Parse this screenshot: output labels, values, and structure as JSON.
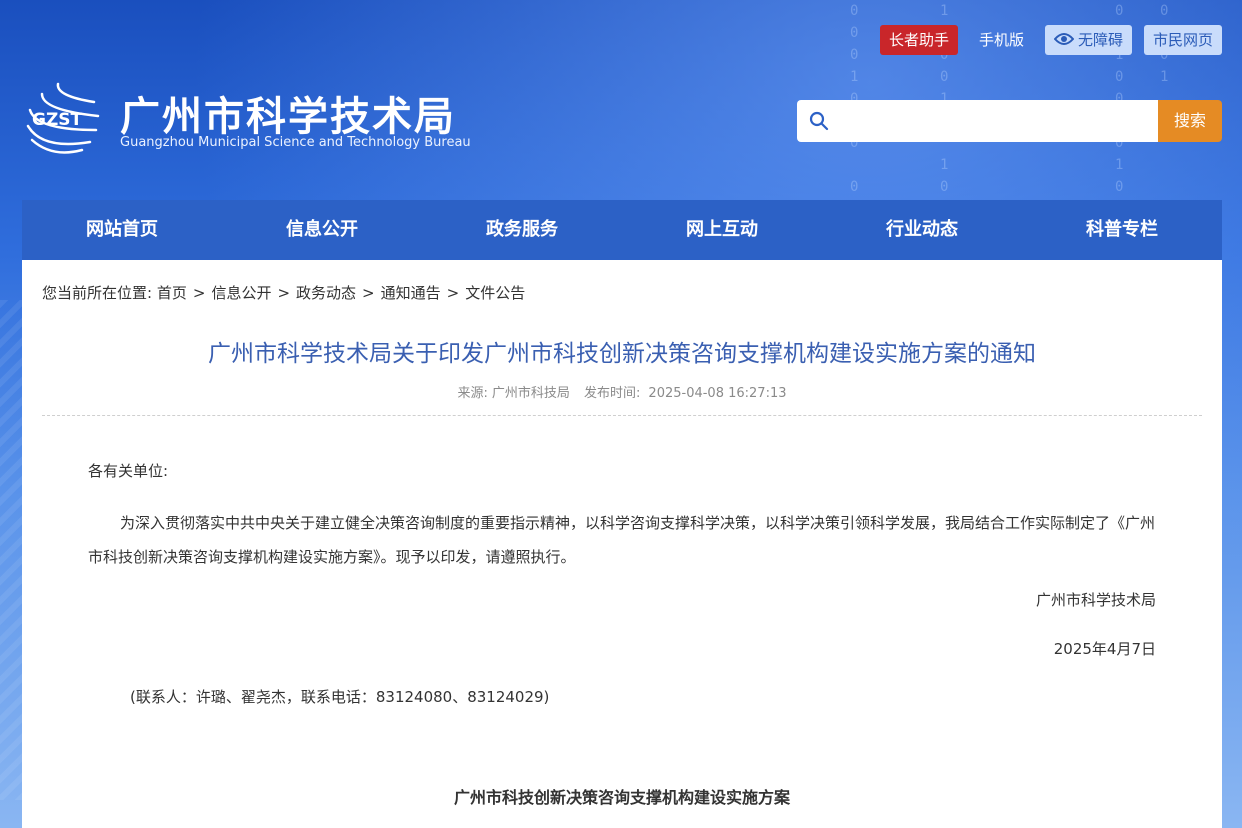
{
  "header": {
    "logo_text": "GZST",
    "site_title": "广州市科学技术局",
    "site_subtitle": "Guangzhou Municipal Science and Technology Bureau",
    "top_links": {
      "elderly": "长者助手",
      "mobile": "手机版",
      "accessibility": "无障碍",
      "citizen": "市民网页"
    },
    "search": {
      "placeholder": "",
      "button_label": "搜索"
    }
  },
  "nav": {
    "items": [
      "网站首页",
      "信息公开",
      "政务服务",
      "网上互动",
      "行业动态",
      "科普专栏"
    ]
  },
  "breadcrumb": {
    "prefix": "您当前所在位置:",
    "items": [
      "首页",
      "信息公开",
      "政务动态",
      "通知通告",
      "文件公告"
    ],
    "separator": ">"
  },
  "article": {
    "title": "广州市科学技术局关于印发广州市科技创新决策咨询支撑机构建设实施方案的通知",
    "source_label": "来源:",
    "source": "广州市科技局",
    "time_label": "发布时间:",
    "time": "2025-04-08 16:27:13",
    "salutation": "各有关单位:",
    "body": "为深入贯彻落实中共中央关于建立健全决策咨询制度的重要指示精神，以科学咨询支撑科学决策，以科学决策引领科学发展，我局结合工作实际制定了《广州市科技创新决策咨询支撑机构建设实施方案》。现予以印发，请遵照执行。",
    "signature": "广州市科学技术局",
    "date": "2025年4月7日",
    "contact": "(联系人：许璐、翟尧杰，联系电话：83124080、83124029)",
    "plan_title": "广州市科技创新决策咨询支撑机构建设实施方案"
  },
  "colors": {
    "nav_bg": "#2c61c6",
    "title_blue": "#3a5fb1",
    "search_button": "#e58b24",
    "elderly_red": "#c9262a"
  }
}
